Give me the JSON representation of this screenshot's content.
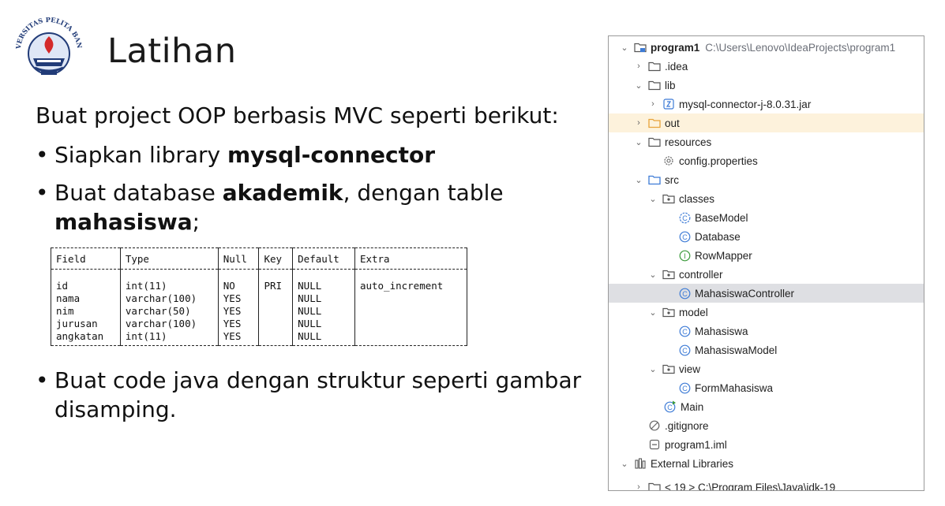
{
  "slide": {
    "title": "Latihan",
    "intro": "Buat project OOP berbasis MVC seperti berikut:",
    "bullets": {
      "b1_pre": "Siapkan library ",
      "b1_bold": "mysql-connector",
      "b2_pre": "Buat database ",
      "b2_bold1": "akademik",
      "b2_mid": ", dengan table",
      "b2_bold2": "mahasiswa",
      "b2_end": ";",
      "b3_line1": "Buat code java dengan struktur seperti gambar",
      "b3_line2": "disamping."
    },
    "bullet_char": "•",
    "logo_text": "UNIVERSITAS PELITA BANGSA"
  },
  "table": {
    "headers": [
      "Field",
      "Type",
      "Null",
      "Key",
      "Default",
      "Extra"
    ],
    "rows": [
      [
        "id",
        "int(11)",
        "NO",
        "PRI",
        "NULL",
        "auto_increment"
      ],
      [
        "nama",
        "varchar(100)",
        "YES",
        "",
        "NULL",
        ""
      ],
      [
        "nim",
        "varchar(50)",
        "YES",
        "",
        "NULL",
        ""
      ],
      [
        "jurusan",
        "varchar(100)",
        "YES",
        "",
        "NULL",
        ""
      ],
      [
        "angkatan",
        "int(11)",
        "YES",
        "",
        "NULL",
        ""
      ]
    ]
  },
  "tree": {
    "project_name": "program1",
    "project_path": "C:\\Users\\Lenovo\\IdeaProjects\\program1",
    "idea": ".idea",
    "lib": "lib",
    "jar": "mysql-connector-j-8.0.31.jar",
    "out": "out",
    "resources": "resources",
    "config": "config.properties",
    "src": "src",
    "classes": "classes",
    "basemodel": "BaseModel",
    "database": "Database",
    "rowmapper": "RowMapper",
    "controller": "controller",
    "mahasiswacontroller": "MahasiswaController",
    "model": "model",
    "mahasiswa": "Mahasiswa",
    "mahasiswamodel": "MahasiswaModel",
    "view": "view",
    "formmahasiswa": "FormMahasiswa",
    "main": "Main",
    "gitignore": ".gitignore",
    "iml": "program1.iml",
    "external": "External Libraries",
    "jdk_partial": "< 19 >  C:\\Program Files\\Java\\jdk-19"
  },
  "colors": {
    "class_icon": "#3d7bd6",
    "interface_icon": "#3a9a3a",
    "out_folder": "#e8a33a",
    "selected_row": "#dedfe3",
    "out_row": "#fdf2dc"
  }
}
